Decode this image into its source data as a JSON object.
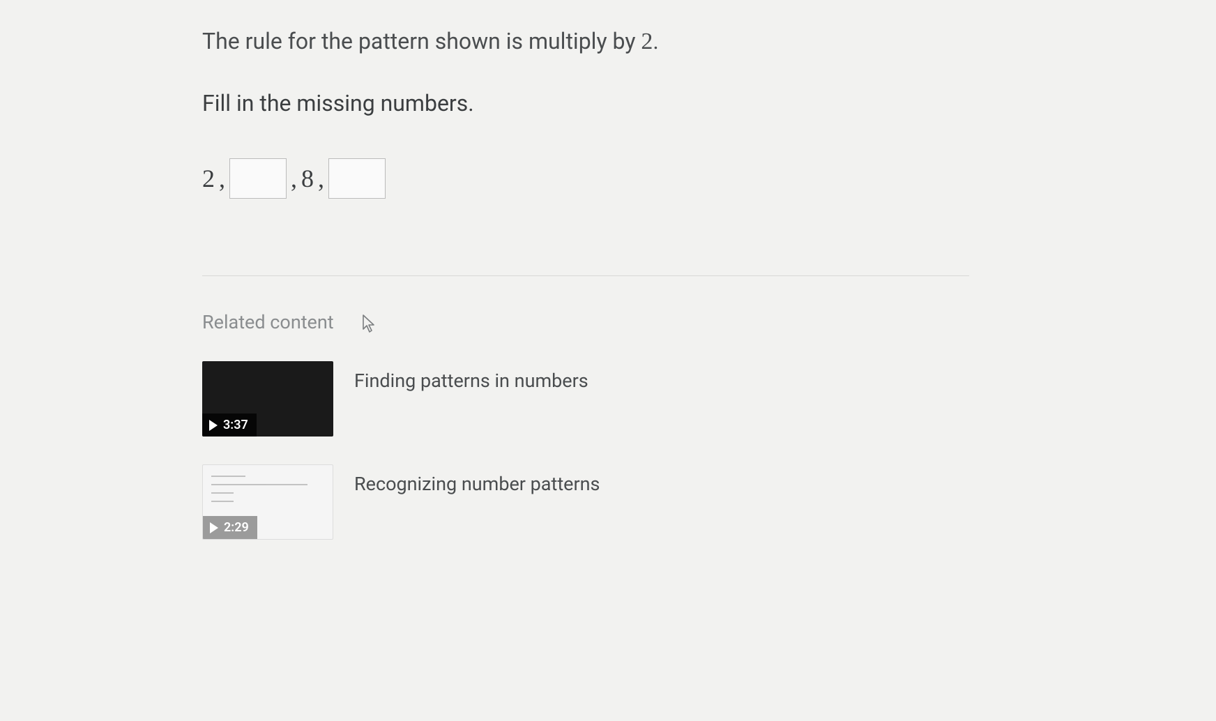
{
  "question": {
    "line1_prefix": "The rule for the pattern shown is multiply by ",
    "line1_number": "2",
    "line1_suffix": ".",
    "line2": "Fill in the missing numbers."
  },
  "sequence": {
    "term1": "2",
    "sep1": ",",
    "input1_value": "",
    "sep2": ", ",
    "term3": "8",
    "sep3": ",",
    "input2_value": ""
  },
  "related": {
    "heading": "Related content",
    "items": [
      {
        "title": "Finding patterns in numbers",
        "duration": "3:37",
        "thumb_style": "dark"
      },
      {
        "title": "Recognizing number patterns",
        "duration": "2:29",
        "thumb_style": "light"
      }
    ]
  }
}
